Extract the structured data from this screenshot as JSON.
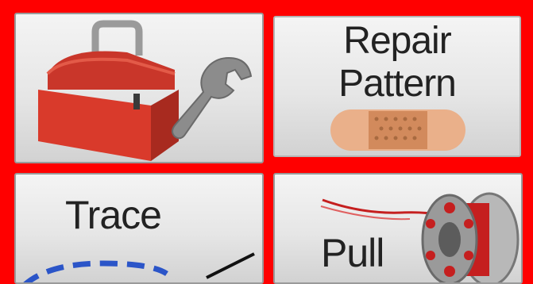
{
  "tiles": {
    "tools": {
      "icon": "toolbox-wrench-icon"
    },
    "repair": {
      "line1": "Repair",
      "line2": "Pattern",
      "icon": "bandage-icon"
    },
    "trace": {
      "label": "Trace",
      "icon": "dashed-curve-icon"
    },
    "pull": {
      "label": "Pull",
      "icon": "thread-spool-icon"
    }
  },
  "colors": {
    "frame": "#ff0000",
    "toolbox": "#d93a2b",
    "bandage": "#e9a77e",
    "trace_line": "#2b55c8",
    "spool_thread": "#c51f1f"
  }
}
